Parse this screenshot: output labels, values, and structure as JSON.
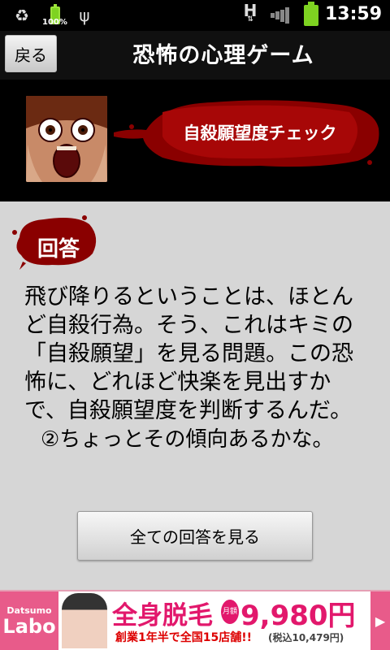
{
  "status_bar": {
    "battery_percent": "100%",
    "time": "13:59",
    "signal": "H"
  },
  "titlebar": {
    "back_label": "戻る",
    "title": "恐怖の心理ゲーム"
  },
  "banner": {
    "section_label": "自殺願望度チェック"
  },
  "content": {
    "answer_label": "回答",
    "answer_text": "飛び降りるということは、ほとんど自殺行為。そう、これはキミの「自殺願望」を見る問題。この恐怖に、どれほど快楽を見出すかで、自殺願望度を判断するんだ。",
    "choice_text": "②ちょっとその傾向あるかな。",
    "all_answers_button": "全ての回答を見る"
  },
  "ad": {
    "logo_line1": "Datsumo",
    "logo_line2": "Labo",
    "headline": "全身脱毛",
    "badge": "月額",
    "price": "9,980円",
    "subline": "創業1年半で全国15店舗!!",
    "tax_note": "(税込10,479円)"
  },
  "colors": {
    "blood_red": "#8a0000",
    "ad_pink": "#e2186c",
    "background": "#d6d6d6"
  }
}
